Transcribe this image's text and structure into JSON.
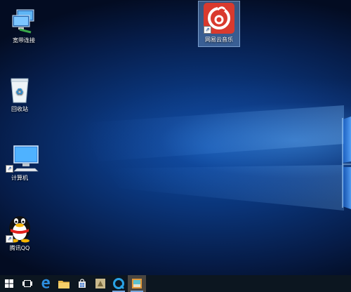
{
  "desktop": {
    "icons": [
      {
        "label": "宽带连接",
        "icon": "network-connection-icon"
      },
      {
        "label": "回收站",
        "icon": "recycle-bin-icon"
      },
      {
        "label": "计算机",
        "icon": "computer-icon"
      },
      {
        "label": "腾讯QQ",
        "icon": "qq-penguin-icon"
      },
      {
        "label": "网易云音乐",
        "icon": "netease-music-icon",
        "selected": true
      }
    ]
  },
  "taskbar": {
    "items": [
      {
        "icon": "windows-start-icon"
      },
      {
        "icon": "task-view-icon"
      },
      {
        "icon": "edge-browser-icon"
      },
      {
        "icon": "file-explorer-icon"
      },
      {
        "icon": "store-icon"
      },
      {
        "icon": "app-icon"
      },
      {
        "icon": "qq-browser-icon"
      },
      {
        "icon": "active-app-icon",
        "active": true
      }
    ]
  },
  "colors": {
    "accent": "#1e6fd9",
    "taskbar": "#0c1620",
    "netease_red": "#d93a2e"
  }
}
